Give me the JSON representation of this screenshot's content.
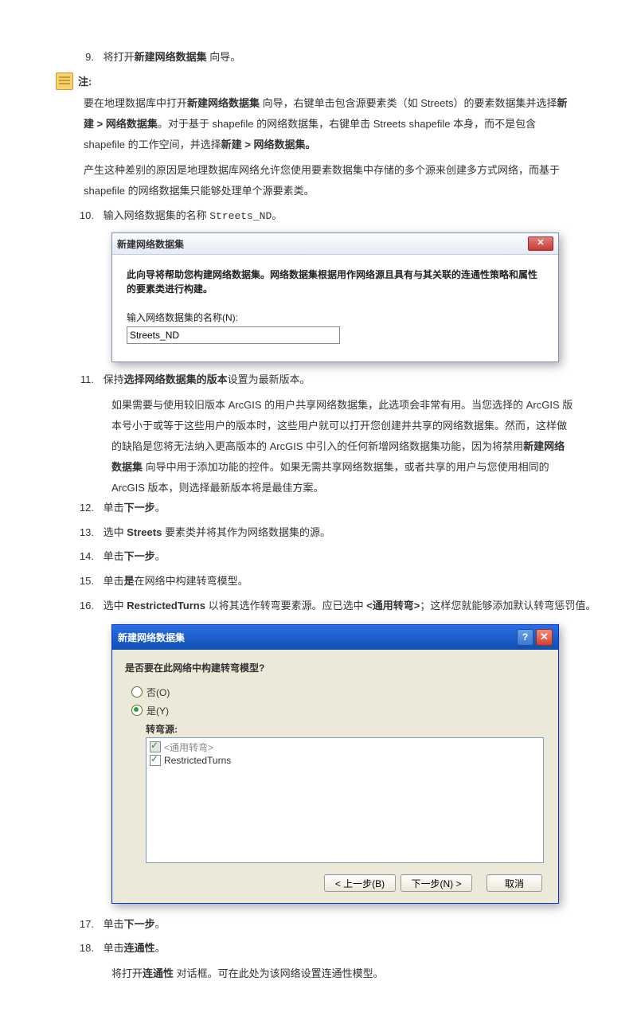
{
  "step9": {
    "num": "9.",
    "t1": "将打开",
    "b1": "新建网络数据集",
    "t2": " 向导。"
  },
  "noteLabel": "注:",
  "noteLine1": {
    "t1": "要在地理数据库中打开",
    "b1": "新建网络数据集",
    "t2": " 向导，右键单击包含源要素类（如 Streets）的要素数据集并选择",
    "b2": "新建 > 网络数据集",
    "t3": "。对于基于 shapefile 的网络数据集，右键单击 Streets shapefile 本身，而不是包含 shapefile 的工作空间，并选择",
    "b3": "新建 > 网络数据集。"
  },
  "noteLine2": "产生这种差别的原因是地理数据库网络允许您使用要素数据集中存储的多个源来创建多方式网络，而基于 shapefile 的网络数据集只能够处理单个源要素类。",
  "step10": {
    "num": "10.",
    "t1": "输入网络数据集的名称 ",
    "m1": "Streets_ND",
    "t2": "。"
  },
  "dlg1": {
    "title": "新建网络数据集",
    "closeX": "✕",
    "msg": "此向导将帮助您构建网络数据集。网络数据集根据用作网络源且具有与其关联的连通性策略和属性的要素类进行构建。",
    "label": "输入网络数据集的名称(N):",
    "value": "Streets_ND"
  },
  "step11": {
    "num": "11.",
    "t1": "保持",
    "b1": "选择网络数据集的版本",
    "t2": "设置为最新版本。"
  },
  "step11body": "如果需要与使用较旧版本 ArcGIS 的用户共享网络数据集，此选项会非常有用。当您选择的 ArcGIS 版本号小于或等于这些用户的版本时，这些用户就可以打开您创建并共享的网络数据集。然而，这样做的缺陷是您将无法纳入更高版本的 ArcGIS 中引入的任何新增网络数据集功能，因为将禁用新建网络数据集 向导中用于添加功能的控件。如果无需共享网络数据集，或者共享的用户与您使用相同的 ArcGIS 版本，则选择最新版本将是最佳方案。",
  "step11body_bold": "新建网络数据集",
  "step12": {
    "num": "12.",
    "t1": "单击",
    "b1": "下一步",
    "t2": "。"
  },
  "step13": {
    "num": "13.",
    "t1": "选中 ",
    "b1": "Streets",
    "t2": " 要素类并将其作为网络数据集的源。"
  },
  "step14": {
    "num": "14.",
    "t1": "单击",
    "b1": "下一步",
    "t2": "。"
  },
  "step15": {
    "num": "15.",
    "t1": "单击",
    "b1": "是",
    "t2": "在网络中构建转弯模型。"
  },
  "step16": {
    "num": "16.",
    "t1": "选中 ",
    "b1": "RestrictedTurns",
    "t2": " 以将其选作转弯要素源。应已选中 ",
    "b2": "<通用转弯>",
    "t3": "；这样您就能够添加默认转弯惩罚值。"
  },
  "dlg2": {
    "title": "新建网络数据集",
    "question": "是否要在此网络中构建转弯模型?",
    "optNo": "否(O)",
    "optYes": "是(Y)",
    "subLabel": "转弯源:",
    "item1": "<通用转弯>",
    "item2": "RestrictedTurns",
    "back": "< 上一步(B)",
    "next": "下一步(N) >",
    "cancel": "取消"
  },
  "step17": {
    "num": "17.",
    "t1": "单击",
    "b1": "下一步",
    "t2": "。"
  },
  "step18": {
    "num": "18.",
    "t1": "单击",
    "b1": "连通性",
    "t2": "。"
  },
  "step18body": {
    "t1": "将打开",
    "b1": "连通性",
    "t2": " 对话框。可在此处为该网络设置连通性模型。"
  }
}
